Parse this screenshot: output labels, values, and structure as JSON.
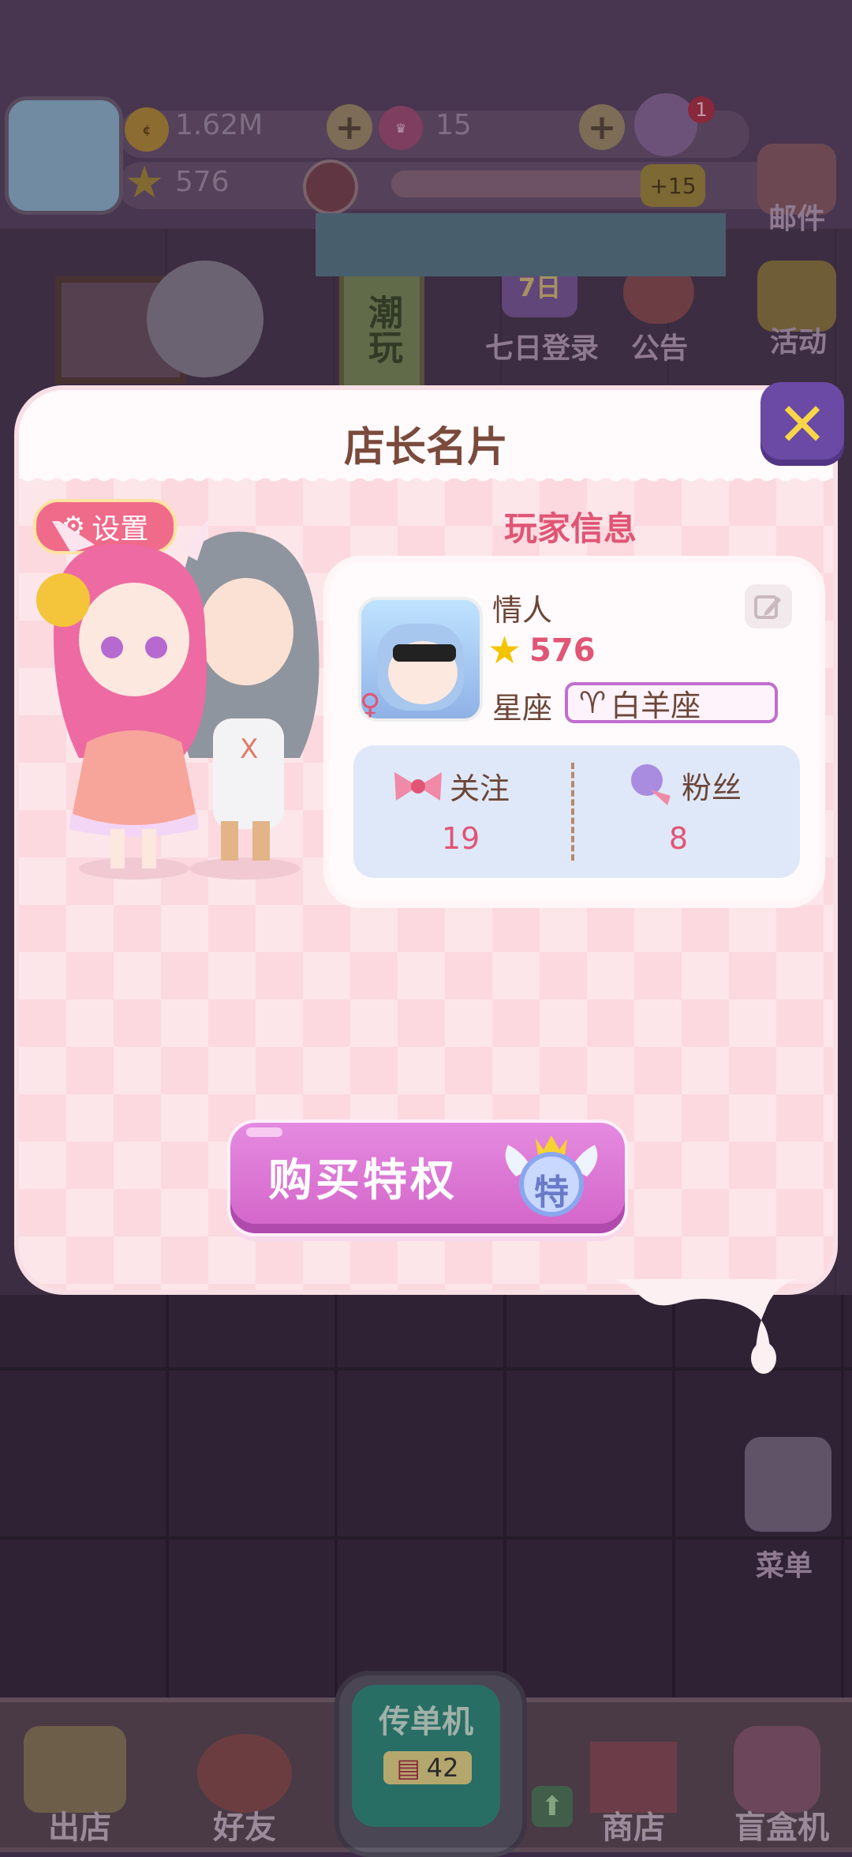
{
  "hud": {
    "coins": "1.62M",
    "crowns": "15",
    "stars": "576",
    "bonus": "+15",
    "notification_count": "1"
  },
  "side_menu": {
    "mail": "邮件",
    "seven_day_login": "七日登录",
    "seven_day_badge": "7日",
    "announcement": "公告",
    "activity": "活动",
    "menu": "菜单",
    "shop_sign": "潮玩",
    "left_label": "情人"
  },
  "modal": {
    "title": "店长名片",
    "settings_label": "设置",
    "section_title": "玩家信息",
    "player": {
      "name": "情人",
      "level": "576",
      "zodiac_label": "星座",
      "zodiac_symbol": "♈",
      "zodiac_value": "白羊座"
    },
    "follow": {
      "label": "关注",
      "count": "19"
    },
    "fans": {
      "label": "粉丝",
      "count": "8"
    },
    "buy_button": "购买特权",
    "privilege_badge": "特"
  },
  "bottom_nav": {
    "leave_shop": "出店",
    "friends": "好友",
    "flyer_machine": "传单机",
    "flyer_count": "42",
    "shop": "商店",
    "blind_box": "盲盒机"
  },
  "colors": {
    "accent_pink": "#e05575",
    "close_purple": "#6a4aa5",
    "button_purple": "#d264c8"
  }
}
